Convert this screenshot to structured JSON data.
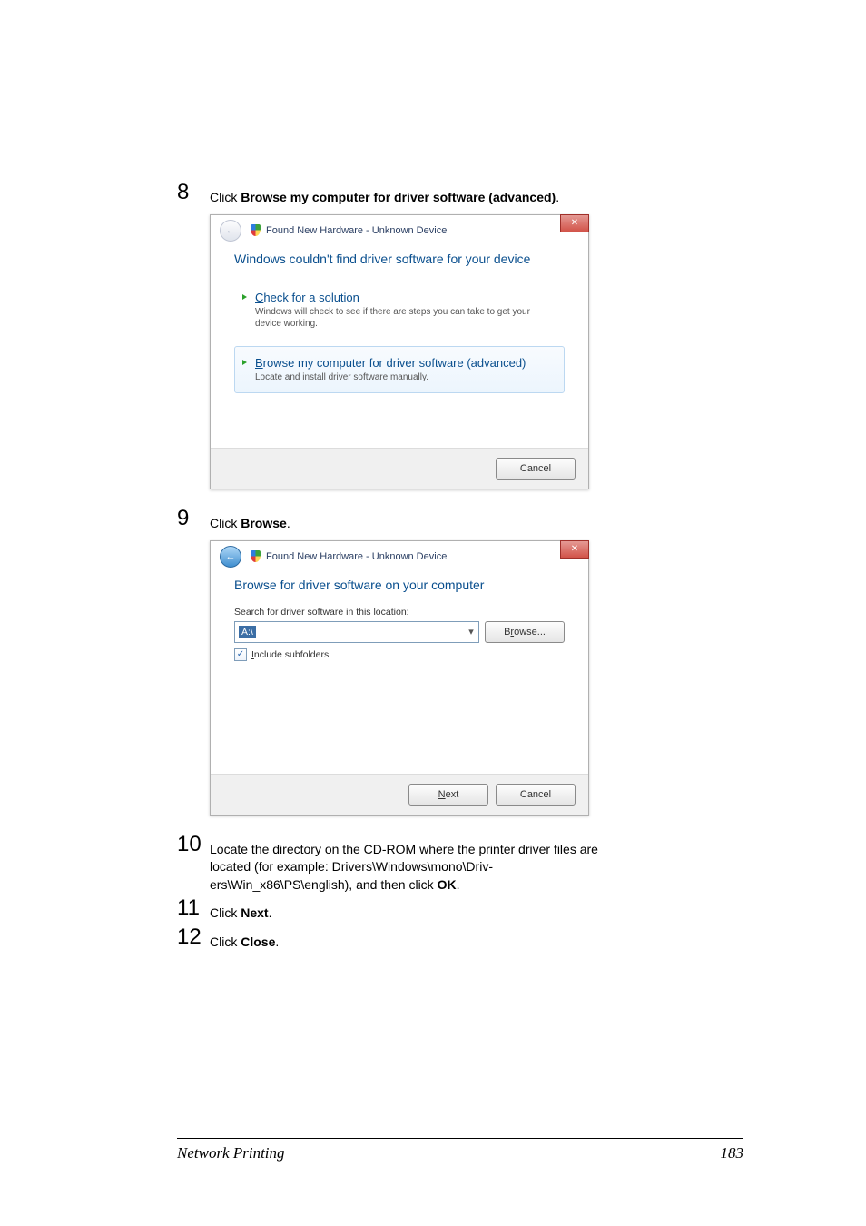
{
  "steps": {
    "s8": {
      "num": "8",
      "pre": "Click ",
      "bold": "Browse my computer for driver software (advanced)",
      "post": "."
    },
    "s9": {
      "num": "9",
      "pre": "Click ",
      "bold": "Browse",
      "post": "."
    },
    "s10": {
      "num": "10",
      "line1": "Locate the directory on the CD-ROM where the printer driver files are ",
      "line2": "located (for example: Drivers\\Windows\\mono\\Driv-",
      "line3_pre": "ers\\Win_x86\\PS\\english), and then click ",
      "line3_bold": "OK",
      "line3_post": "."
    },
    "s11": {
      "num": "11",
      "pre": "Click ",
      "bold": "Next",
      "post": "."
    },
    "s12": {
      "num": "12",
      "pre": "Click ",
      "bold": "Close",
      "post": "."
    }
  },
  "dialog1": {
    "header": "Found New Hardware - Unknown Device",
    "title": "Windows couldn't find driver software for your device",
    "opt1_title": "Check for a solution",
    "opt1_desc": "Windows will check to see if there are steps you can take to get your device working.",
    "opt2_title": "Browse my computer for driver software (advanced)",
    "opt2_desc": "Locate and install driver software manually.",
    "cancel": "Cancel"
  },
  "dialog2": {
    "header": "Found New Hardware - Unknown Device",
    "title": "Browse for driver software on your computer",
    "field_label": "Search for driver software in this location:",
    "combo_value": "A:\\",
    "browse_btn": "Browse...",
    "include_sub": "Include subfolders",
    "next": "Next",
    "cancel": "Cancel"
  },
  "footer": {
    "title": "Network Printing",
    "page": "183"
  }
}
